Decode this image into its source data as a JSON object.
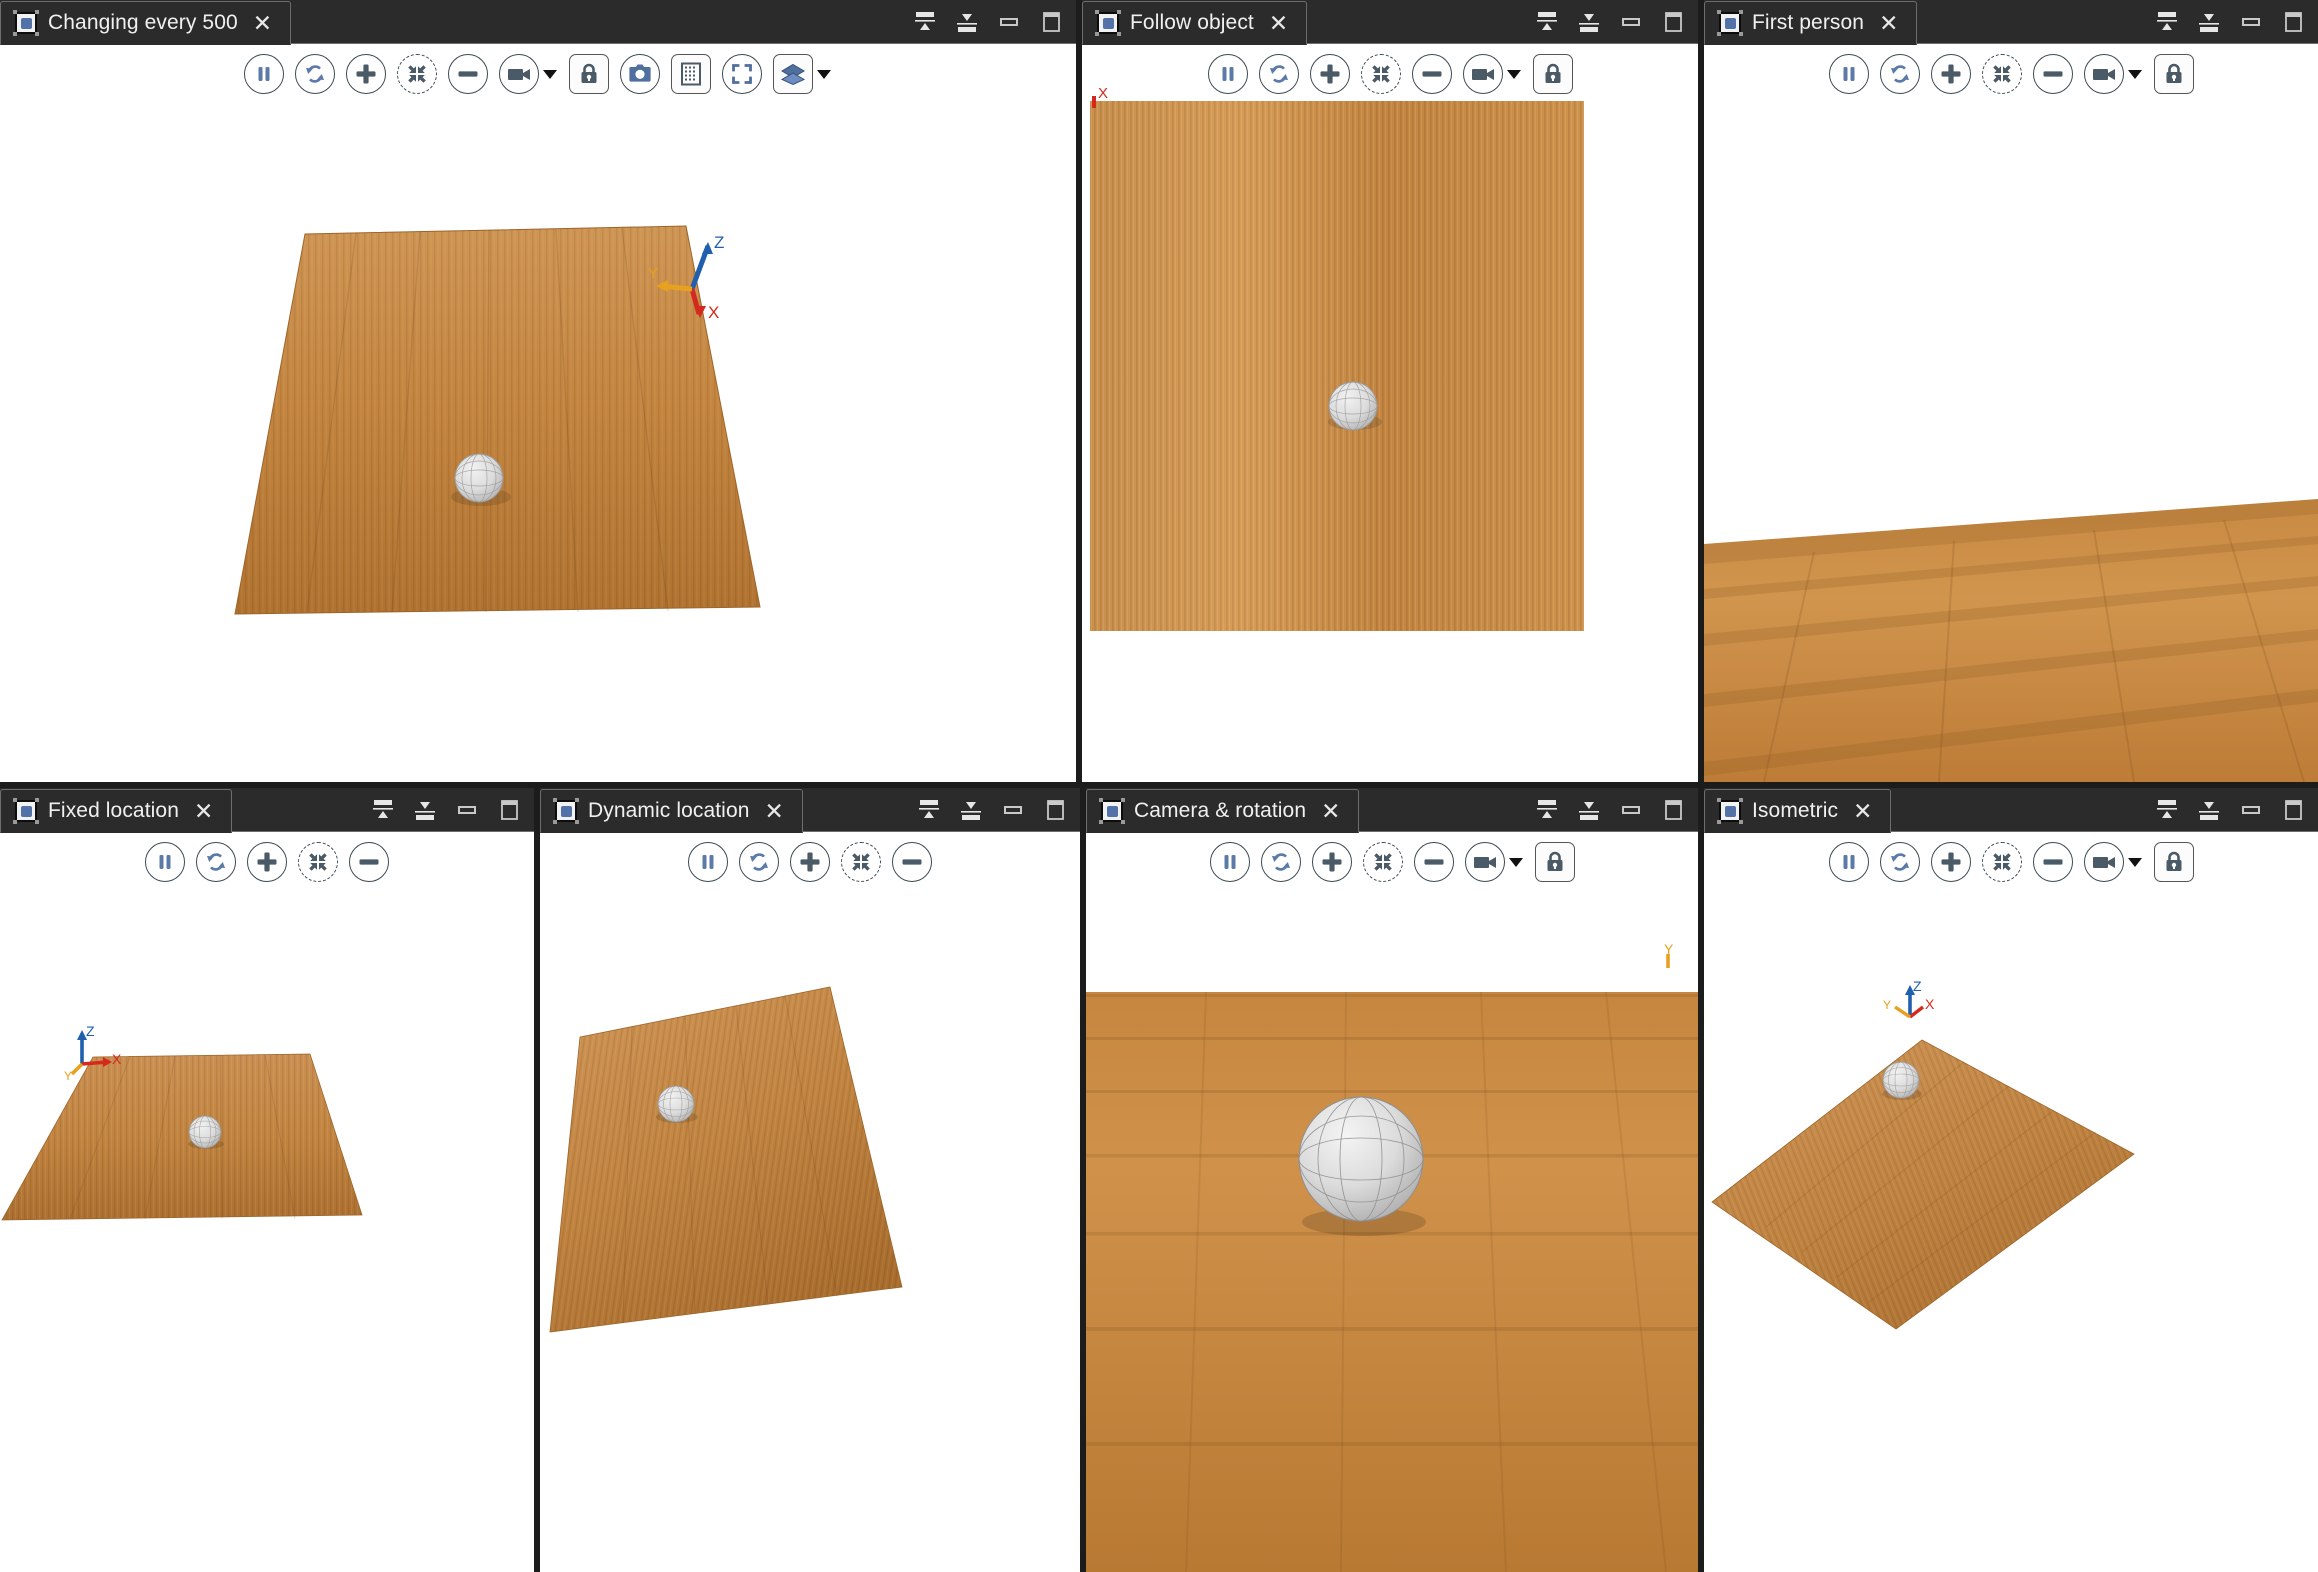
{
  "app": {
    "background_color": "#1c1c1c",
    "panel_titlebar_color": "#2b2b2b",
    "viewport_background": "#ffffff",
    "accent_color": "#5372a8",
    "icon_color": "#4a5a66"
  },
  "window_controls": [
    {
      "name": "collapse-up-button",
      "label": "Collapse up"
    },
    {
      "name": "expand-down-button",
      "label": "Expand down"
    },
    {
      "name": "minimize-button",
      "label": "Minimize"
    },
    {
      "name": "restore-button",
      "label": "Restore"
    }
  ],
  "toolbar_icons": {
    "pause": "pause-icon",
    "reset": "reset-rotation-icon",
    "zoom_in": "zoom-in-icon",
    "fit": "fit-to-view-icon",
    "zoom_out": "zoom-out-icon",
    "camera": "camera-mode-icon",
    "camera_caret": "chevron-down-icon",
    "lock": "lock-icon",
    "snapshot": "snapshot-camera-icon",
    "grid": "grid-toggle-icon",
    "fullscreen": "fullscreen-icon",
    "layers": "layers-icon",
    "layers_caret": "chevron-down-icon"
  },
  "panels": [
    {
      "id": "changing-every-500",
      "title": "Changing every 500",
      "close_label": "✕",
      "toolbar": [
        "pause",
        "reset",
        "zoom_in",
        "fit",
        "zoom_out",
        "camera+caret",
        "lock",
        "snapshot",
        "grid",
        "fullscreen",
        "layers+caret"
      ],
      "axes": {
        "visible": true,
        "z": "Z",
        "y": "Y",
        "x": "X"
      },
      "scene": "perspective-floor-with-sphere"
    },
    {
      "id": "follow-object",
      "title": "Follow object",
      "close_label": "✕",
      "toolbar": [
        "pause",
        "reset",
        "zoom_in",
        "fit",
        "zoom_out",
        "camera+caret",
        "lock"
      ],
      "axes": {
        "visible": true,
        "x": "X"
      },
      "scene": "top-down-floor-with-sphere"
    },
    {
      "id": "first-person",
      "title": "First person",
      "close_label": "✕",
      "toolbar": [
        "pause",
        "reset",
        "zoom_in",
        "fit",
        "zoom_out",
        "camera+caret",
        "lock"
      ],
      "axes": {
        "visible": false
      },
      "scene": "first-person-floor"
    },
    {
      "id": "fixed-location",
      "title": "Fixed location",
      "close_label": "✕",
      "toolbar": [
        "pause",
        "reset",
        "zoom_in",
        "fit",
        "zoom_out"
      ],
      "axes": {
        "visible": true,
        "z": "Z",
        "y": "Y",
        "x": "X"
      },
      "scene": "low-angle-floor-with-sphere"
    },
    {
      "id": "dynamic-location",
      "title": "Dynamic location",
      "close_label": "✕",
      "toolbar": [
        "pause",
        "reset",
        "zoom_in",
        "fit",
        "zoom_out"
      ],
      "axes": {
        "visible": false
      },
      "scene": "tilted-floor-with-sphere"
    },
    {
      "id": "camera-and-rotation",
      "title": "Camera & rotation",
      "close_label": "✕",
      "toolbar": [
        "pause",
        "reset",
        "zoom_in",
        "fit",
        "zoom_out",
        "camera+caret",
        "lock"
      ],
      "axes": {
        "visible": true,
        "y": "Y"
      },
      "scene": "horizon-floor-with-large-sphere"
    },
    {
      "id": "isometric",
      "title": "Isometric",
      "close_label": "✕",
      "toolbar": [
        "pause",
        "reset",
        "zoom_in",
        "fit",
        "zoom_out",
        "camera+caret",
        "lock"
      ],
      "axes": {
        "visible": true,
        "z": "Z",
        "y": "Y",
        "x": "X"
      },
      "scene": "isometric-floor-with-sphere"
    }
  ],
  "axis_colors": {
    "z": "#1f5fae",
    "y": "#e8a020",
    "x": "#d42a1e"
  },
  "wood_colors": {
    "light": "#d89a55",
    "mid": "#c07f3e",
    "dark": "#a8692f",
    "highlight": "#e3ad69"
  },
  "sphere_colors": {
    "fill": "#d9d9d9",
    "line": "#8a8a8a",
    "shadow": "#9a9a9a"
  }
}
